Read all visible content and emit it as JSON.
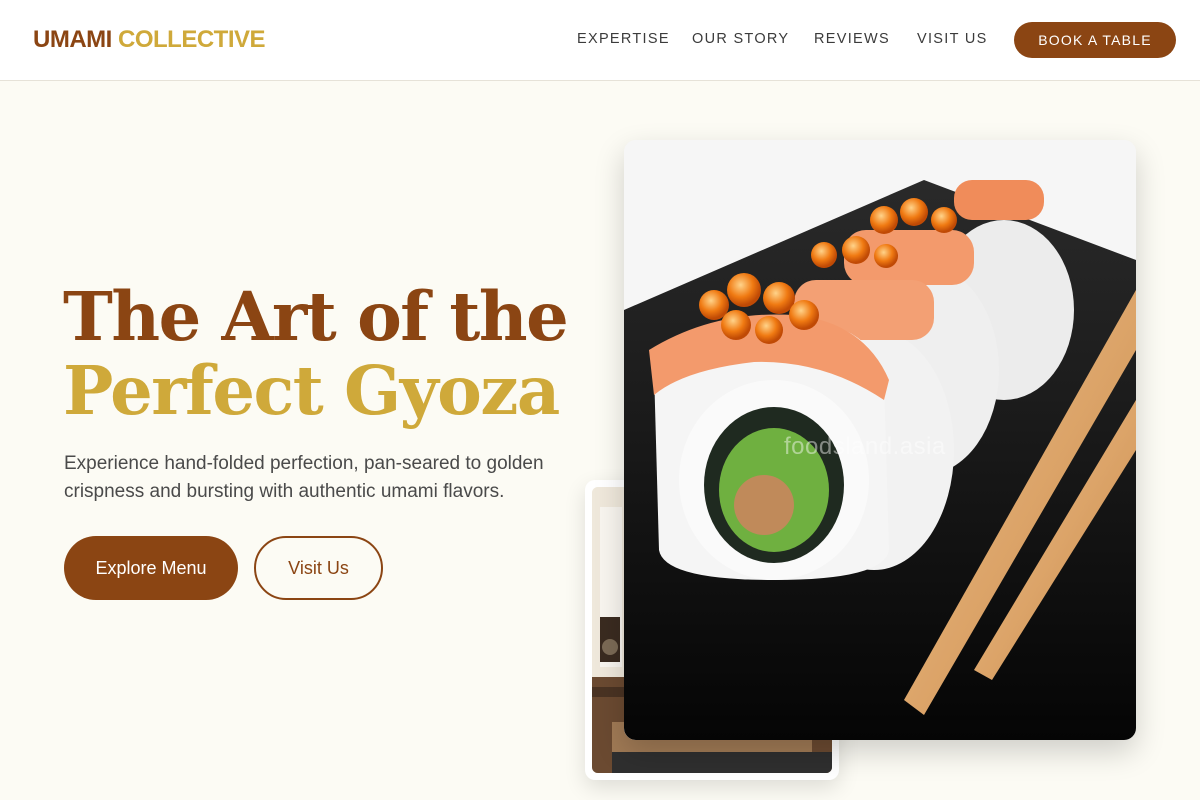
{
  "brand": {
    "word1": "UMAMI",
    "word2": "COLLECTIVE"
  },
  "nav": {
    "items": [
      "EXPERTISE",
      "OUR STORY",
      "REVIEWS",
      "VISIT US"
    ],
    "cta": "BOOK A TABLE"
  },
  "hero": {
    "title_line1": "The Art of the",
    "title_line2": "Perfect Gyoza",
    "description": "Experience hand-folded perfection, pan-seared to golden crispness and bursting with authentic umami flavors.",
    "primary_button": "Explore Menu",
    "secondary_button": "Visit Us"
  },
  "images": {
    "main_watermark": "foodsland.asia"
  },
  "colors": {
    "brand_brown": "#8b4513",
    "brand_gold": "#cfa93a",
    "background": "#fcfbf4"
  }
}
